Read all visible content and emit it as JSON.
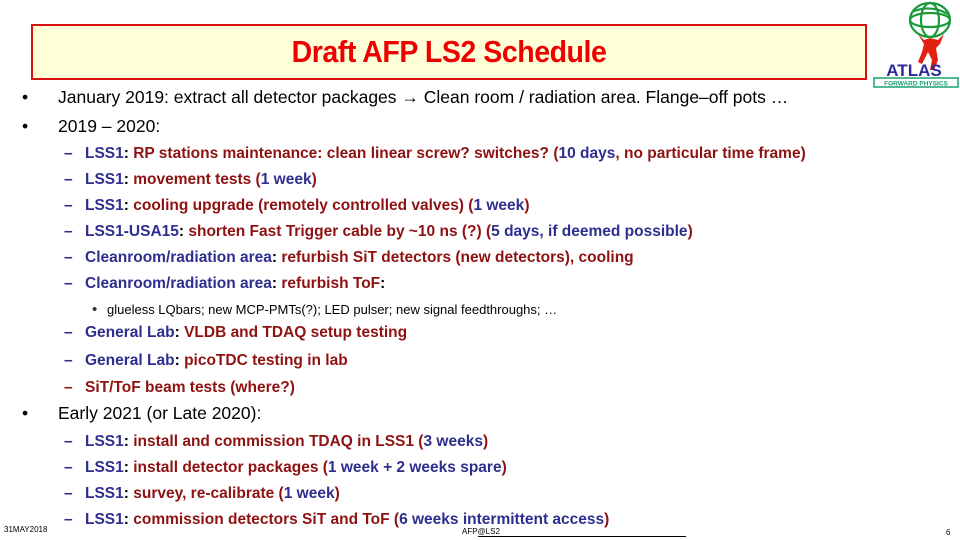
{
  "title": "Draft AFP LS2 Schedule",
  "logo": {
    "text": "ATLAS",
    "subtext": "FORWARD PHYSICS",
    "globe_color": "#1a9a3a",
    "figure_color": "#e02010",
    "text_color": "#2a2a9a"
  },
  "colors": {
    "blue": "#2e2e8f",
    "red": "#8e1212",
    "title_red": "#ee0000",
    "title_bg": "#ffffd8"
  },
  "lines": [
    {
      "level": 1,
      "marker": "•",
      "segments": [
        [
          "January 2019: extract all detector packages → Clean room / radiation area. Flange–off pots …",
          "k"
        ]
      ]
    },
    {
      "level": 1,
      "marker": "•",
      "segments": [
        [
          "2019 – 2020:",
          "k"
        ]
      ]
    },
    {
      "level": 2,
      "marker": "–",
      "marker_color": "b",
      "segments": [
        [
          "LSS1",
          "b"
        ],
        [
          ": ",
          "k"
        ],
        [
          "RP stations maintenance: clean linear screw? switches? (",
          "r"
        ],
        [
          "10 days",
          "b"
        ],
        [
          ", no particular time frame)",
          "r"
        ]
      ]
    },
    {
      "level": 2,
      "marker": "–",
      "marker_color": "b",
      "segments": [
        [
          "LSS1",
          "b"
        ],
        [
          ": ",
          "k"
        ],
        [
          "movement tests (",
          "r"
        ],
        [
          "1 week",
          "b"
        ],
        [
          ")",
          "r"
        ]
      ]
    },
    {
      "level": 2,
      "marker": "–",
      "marker_color": "b",
      "segments": [
        [
          "LSS1",
          "b"
        ],
        [
          ": ",
          "k"
        ],
        [
          "cooling upgrade (remotely controlled valves) (",
          "r"
        ],
        [
          "1 week",
          "b"
        ],
        [
          ")",
          "r"
        ]
      ]
    },
    {
      "level": 2,
      "marker": "–",
      "marker_color": "b",
      "segments": [
        [
          "LSS1-USA15",
          "b"
        ],
        [
          ": ",
          "k"
        ],
        [
          "shorten Fast Trigger cable by ~10 ns (?) (",
          "r"
        ],
        [
          "5 days, if deemed possible",
          "b"
        ],
        [
          ")",
          "r"
        ]
      ]
    },
    {
      "level": 2,
      "marker": "–",
      "marker_color": "b",
      "segments": [
        [
          "Cleanroom/radiation area",
          "b"
        ],
        [
          ": ",
          "k"
        ],
        [
          "refurbish SiT detectors (new detectors), cooling",
          "r"
        ]
      ]
    },
    {
      "level": 2,
      "marker": "–",
      "marker_color": "b",
      "segments": [
        [
          "Cleanroom/radiation area",
          "b"
        ],
        [
          ": ",
          "k"
        ],
        [
          "refurbish ToF",
          "r"
        ],
        [
          ":",
          "k"
        ]
      ]
    },
    {
      "level": 3,
      "marker": "•",
      "segments": [
        [
          "glueless LQbars; new MCP-PMTs(?); LED pulser; new signal feedthroughs; …",
          "k"
        ]
      ]
    },
    {
      "level": 2,
      "marker": "–",
      "marker_color": "b",
      "segments": [
        [
          "General Lab",
          "b"
        ],
        [
          ": ",
          "k"
        ],
        [
          "VLDB and TDAQ setup testing",
          "r"
        ]
      ]
    },
    {
      "level": 2,
      "marker": "–",
      "marker_color": "b",
      "segments": [
        [
          "General Lab",
          "b"
        ],
        [
          ": ",
          "k"
        ],
        [
          "picoTDC testing in lab",
          "r"
        ]
      ]
    },
    {
      "level": 2,
      "marker": "–",
      "marker_color": "r",
      "segments": [
        [
          "SiT/ToF beam tests (where?)",
          "r"
        ]
      ]
    },
    {
      "level": 1,
      "marker": "•",
      "segments": [
        [
          "Early 2021 (or Late 2020):",
          "k"
        ]
      ]
    },
    {
      "level": 2,
      "marker": "–",
      "marker_color": "b",
      "segments": [
        [
          "LSS1",
          "b"
        ],
        [
          ": ",
          "k"
        ],
        [
          "install and commission TDAQ in LSS1 (",
          "r"
        ],
        [
          "3 weeks",
          "b"
        ],
        [
          ")",
          "r"
        ]
      ]
    },
    {
      "level": 2,
      "marker": "–",
      "marker_color": "b",
      "segments": [
        [
          "LSS1",
          "b"
        ],
        [
          ": ",
          "k"
        ],
        [
          "install detector packages (",
          "r"
        ],
        [
          "1 week + 2 weeks spare",
          "b"
        ],
        [
          ")",
          "r"
        ]
      ]
    },
    {
      "level": 2,
      "marker": "–",
      "marker_color": "b",
      "segments": [
        [
          "LSS1",
          "b"
        ],
        [
          ": ",
          "k"
        ],
        [
          "survey, re-calibrate (",
          "r"
        ],
        [
          "1 week",
          "b"
        ],
        [
          ")",
          "r"
        ]
      ]
    },
    {
      "level": 2,
      "marker": "–",
      "marker_color": "b",
      "segments": [
        [
          "LSS1",
          "b"
        ],
        [
          ": ",
          "k"
        ],
        [
          "commission detectors SiT and ToF (",
          "r"
        ],
        [
          "6 weeks intermittent access",
          "b"
        ],
        [
          ")",
          "r"
        ]
      ]
    }
  ],
  "footer": {
    "date": "31MAY2018",
    "center": "AFP@LS2",
    "page": "6"
  }
}
